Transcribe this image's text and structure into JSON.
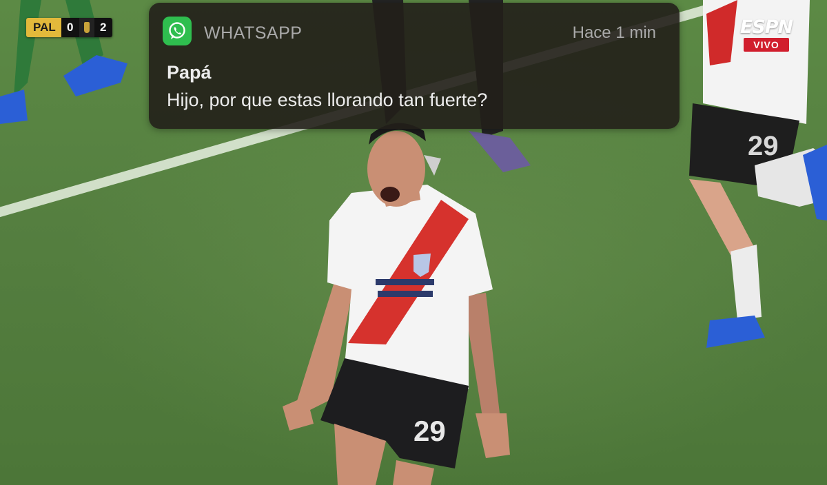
{
  "scoreboard": {
    "home_team": "PAL",
    "home_score": "0",
    "away_score": "2"
  },
  "broadcaster": {
    "logo": "ESPN",
    "live_label": "VIVO",
    "accent_color": "#d11e2d"
  },
  "notification": {
    "app_icon": "whatsapp-icon",
    "app_name": "WHATSAPP",
    "time": "Hace 1 min",
    "sender": "Papá",
    "message": "Hijo, por que estas llorando tan fuerte?",
    "accent_color": "#2fbe4f"
  },
  "player": {
    "shirt_number": "29"
  }
}
